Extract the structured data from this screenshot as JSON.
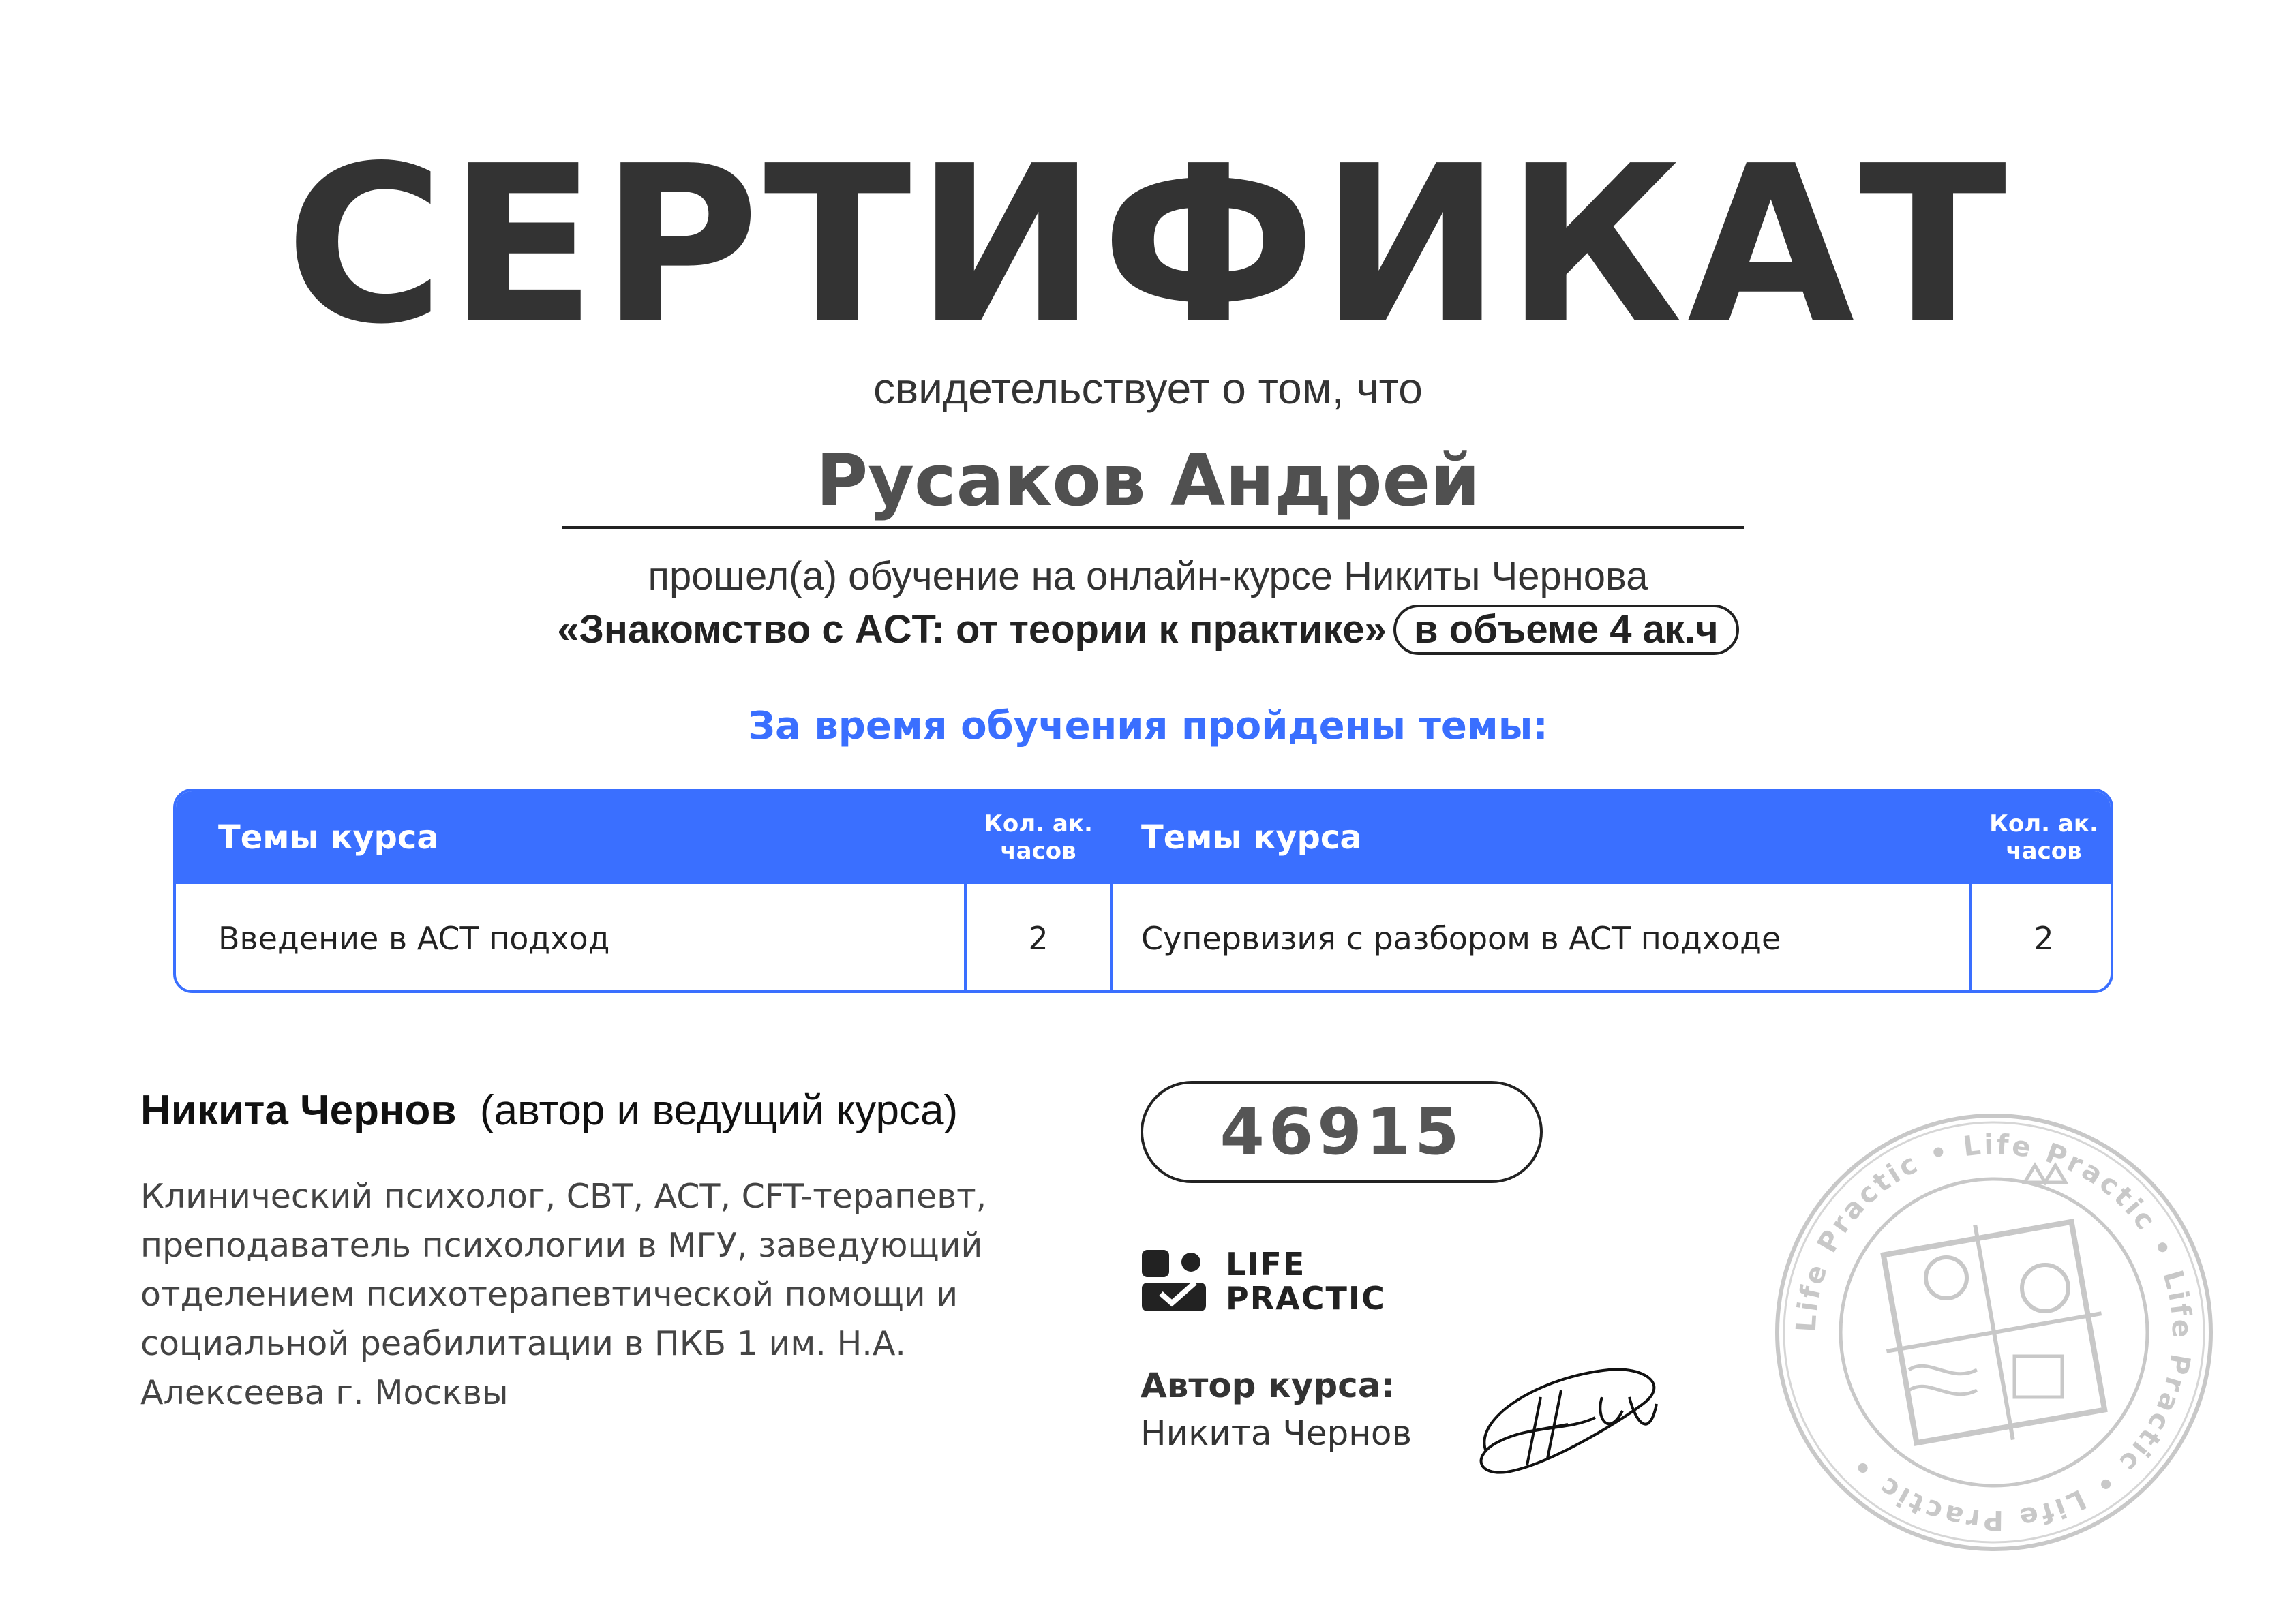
{
  "header": {
    "title": "СЕРТИФИКАТ",
    "subtitle": "свидетельствует о том, что",
    "recipient": "Русаков Андрей",
    "course_line": "прошел(а) обучение на онлайн-курсе Никиты Чернова",
    "course_name": "«Знакомство с ACT: от теории к практике»",
    "volume": "в объеме 4 ак.ч"
  },
  "topics_heading": "За время обучения пройдены темы:",
  "table": {
    "header_topics": "Темы курса",
    "header_hours_1": "Кол. ак.",
    "header_hours_2": "часов",
    "rows": [
      {
        "topic": "Введение в ACT подход",
        "hours": "2"
      },
      {
        "topic": "Супервизия с разбором в ACT подходе",
        "hours": "2"
      }
    ]
  },
  "author": {
    "name": "Никита Чернов",
    "role": "(автор и ведущий курса)",
    "bio": "Клинический психолог, CBT, ACT, CFT-терапевт, преподаватель психологии в МГУ, заведующий отделением психотерапевтической помощи и социальной реабилитации в ПКБ 1 им. Н.А. Алексеева г. Москвы"
  },
  "certificate_number": "46915",
  "logo": {
    "line1": "LIFE",
    "line2": "PRACTIC",
    "icon": "life-practic-logo-icon"
  },
  "signature_block": {
    "label": "Автор курса:",
    "name": "Никита Чернов",
    "signature_text": "НЧер"
  },
  "seal": {
    "ring_text": "Life Practic • Life Practic • Life Practic • Life Practic •",
    "icon": "seal-icon"
  },
  "colors": {
    "accent": "#3a6fff",
    "text": "#333333",
    "seal": "#c8c8c8"
  }
}
